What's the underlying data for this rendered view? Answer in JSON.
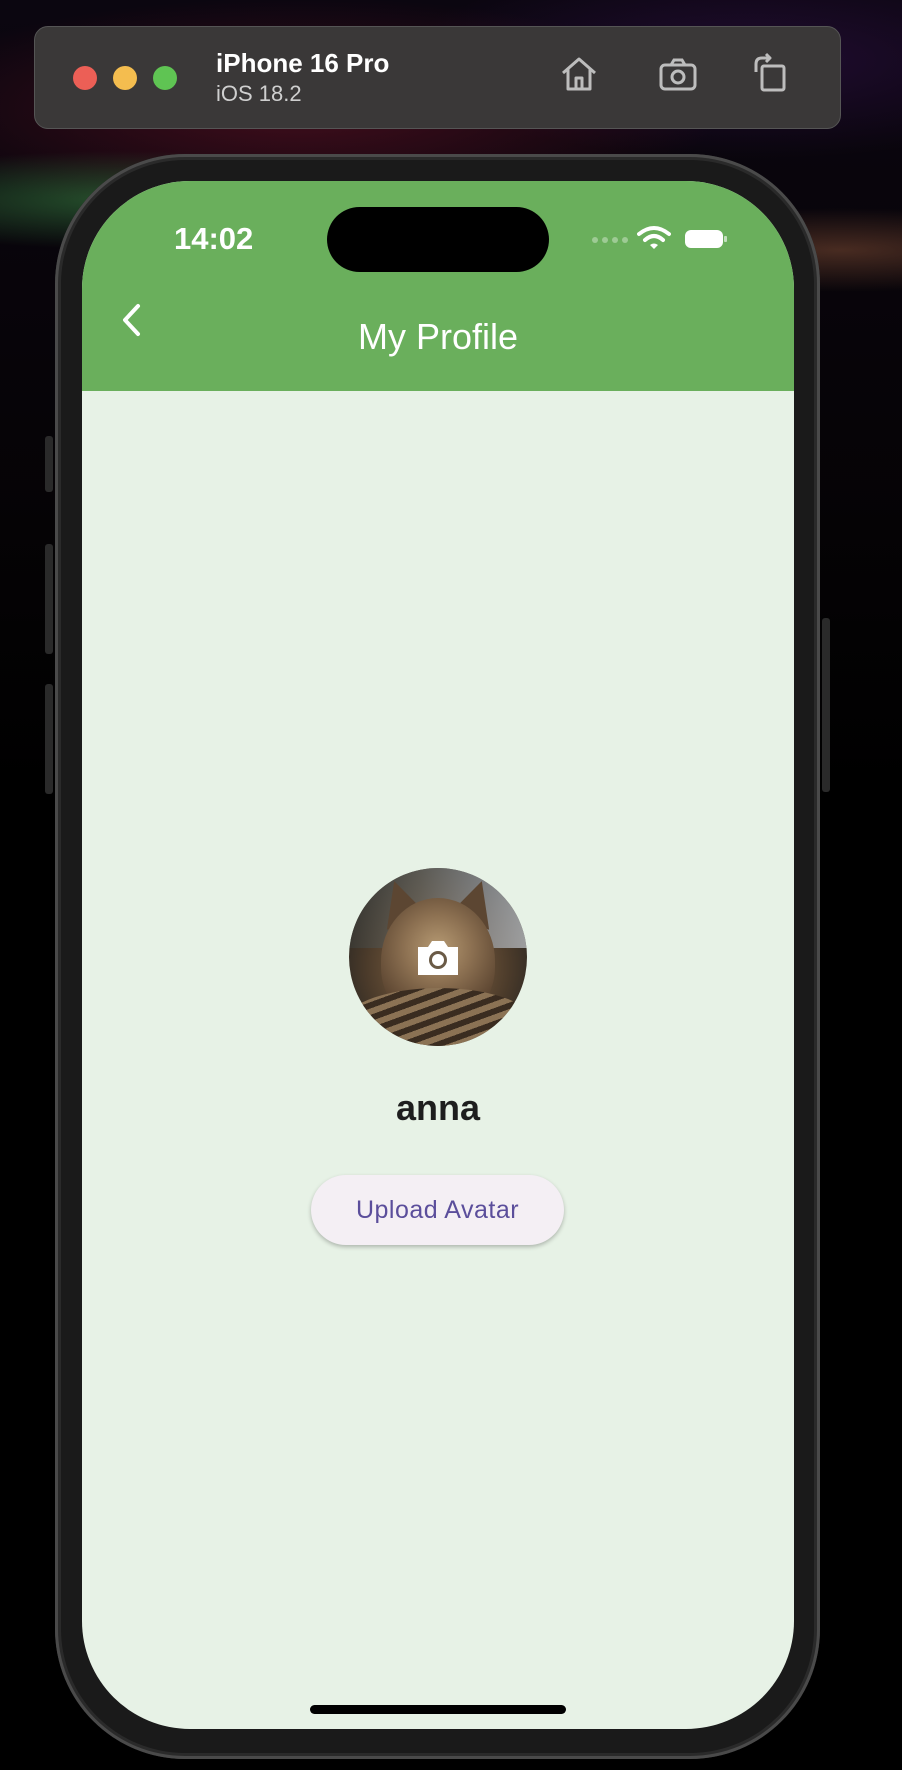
{
  "simulator": {
    "device_name": "iPhone 16 Pro",
    "os_version": "iOS 18.2",
    "window_controls": [
      "close",
      "minimize",
      "zoom"
    ],
    "toolbar_icons": [
      "home-icon",
      "screenshot-icon",
      "rotate-icon"
    ]
  },
  "status_bar": {
    "time": "14:02",
    "icons": [
      "signal-icon",
      "wifi-icon",
      "battery-icon"
    ]
  },
  "app_bar": {
    "title": "My Profile",
    "back_icon": "chevron-left-icon",
    "color": "#6aaf5c"
  },
  "profile": {
    "avatar_overlay_icon": "camera-icon",
    "username": "anna",
    "upload_button_label": "Upload Avatar"
  },
  "colors": {
    "screen_background": "#e7f2e6",
    "button_text": "#5b4e9b",
    "button_background": "#f4eff4"
  }
}
